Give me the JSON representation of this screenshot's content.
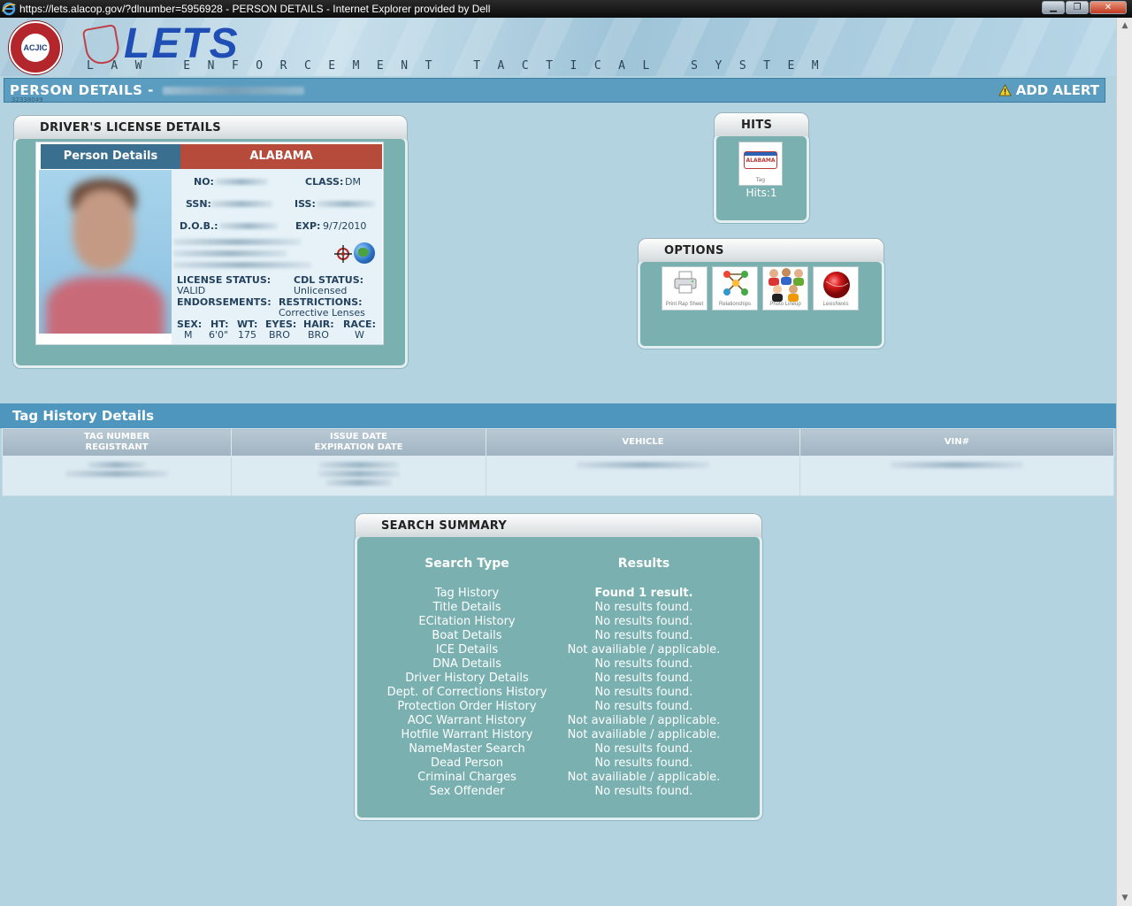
{
  "window": {
    "title": "https://lets.alacop.gov/?dlnumber=5956928 - PERSON DETAILS - Internet Explorer provided by Dell",
    "minimize": "▁",
    "maximize": "❐",
    "close": "✕"
  },
  "header": {
    "seal_text": "ACJIC",
    "logo": "LETS",
    "subtitle": "LAW ENFORCEMENT TACTICAL SYSTEM"
  },
  "person_bar": {
    "title": "PERSON DETAILS -",
    "sub_id": "32338049",
    "add_alert": "ADD ALERT"
  },
  "license_panel": {
    "title": "DRIVER'S LICENSE DETAILS",
    "tab_left": "Person Details",
    "tab_right": "ALABAMA",
    "no_label": "NO:",
    "class_label": "CLASS:",
    "class_value": "DM",
    "ssn_label": "SSN:",
    "iss_label": "ISS:",
    "dob_label": "D.O.B.:",
    "exp_label": "EXP:",
    "exp_value": "9/7/2010",
    "license_status_label": "LICENSE STATUS:",
    "license_status_value": "VALID",
    "cdl_status_label": "CDL STATUS:",
    "cdl_status_value": "Unlicensed",
    "endorsements_label": "ENDORSEMENTS:",
    "restrictions_label": "RESTRICTIONS:",
    "restrictions_value": "Corrective Lenses",
    "sex_label": "SEX:",
    "sex_value": "M",
    "ht_label": "HT:",
    "ht_value": "6'0\"",
    "wt_label": "WT:",
    "wt_value": "175",
    "eyes_label": "EYES:",
    "eyes_value": "BRO",
    "hair_label": "HAIR:",
    "hair_value": "BRO",
    "race_label": "RACE:",
    "race_value": "W"
  },
  "hits_panel": {
    "title": "HITS",
    "tile_plate": "ALABAMA",
    "tile_caption": "Tag",
    "hits_text": "Hits:1"
  },
  "options_panel": {
    "title": "OPTIONS",
    "items": [
      {
        "caption": "Print Rap Sheet",
        "icon": "printer-icon"
      },
      {
        "caption": "Relationships",
        "icon": "relationships-icon"
      },
      {
        "caption": "Photo Lineup",
        "icon": "photo-lineup-icon"
      },
      {
        "caption": "LexisNexis",
        "icon": "lexisnexis-icon"
      }
    ]
  },
  "tag_history": {
    "title": "Tag History Details",
    "columns": [
      "TAG NUMBER",
      "REGISTRANT",
      "ISSUE DATE",
      "EXPIRATION DATE",
      "VEHICLE",
      "VIN#"
    ]
  },
  "search_summary": {
    "title": "SEARCH SUMMARY",
    "type_header": "Search Type",
    "results_header": "Results",
    "rows": [
      {
        "type": "Tag History",
        "result": "Found 1 result."
      },
      {
        "type": "Title Details",
        "result": "No results found."
      },
      {
        "type": "ECitation History",
        "result": "No results found."
      },
      {
        "type": "Boat Details",
        "result": "No results found."
      },
      {
        "type": "ICE Details",
        "result": "Not availiable / applicable."
      },
      {
        "type": "DNA Details",
        "result": "No results found."
      },
      {
        "type": "Driver History Details",
        "result": "No results found."
      },
      {
        "type": "Dept. of Corrections History",
        "result": "No results found."
      },
      {
        "type": "Protection Order History",
        "result": "No results found."
      },
      {
        "type": "AOC Warrant History",
        "result": "Not availiable / applicable."
      },
      {
        "type": "Hotfile Warrant History",
        "result": "Not availiable / applicable."
      },
      {
        "type": "NameMaster Search",
        "result": "No results found."
      },
      {
        "type": "Dead Person",
        "result": "No results found."
      },
      {
        "type": "Criminal Charges",
        "result": "Not availiable / applicable."
      },
      {
        "type": "Sex Offender",
        "result": "No results found."
      }
    ]
  },
  "colors": {
    "page_bg": "#b3d3e1",
    "panel_bg": "#7ab0b0",
    "header_bar": "#5b9dc0",
    "license_red": "#b64b3c",
    "license_blue": "#3b6f90"
  }
}
